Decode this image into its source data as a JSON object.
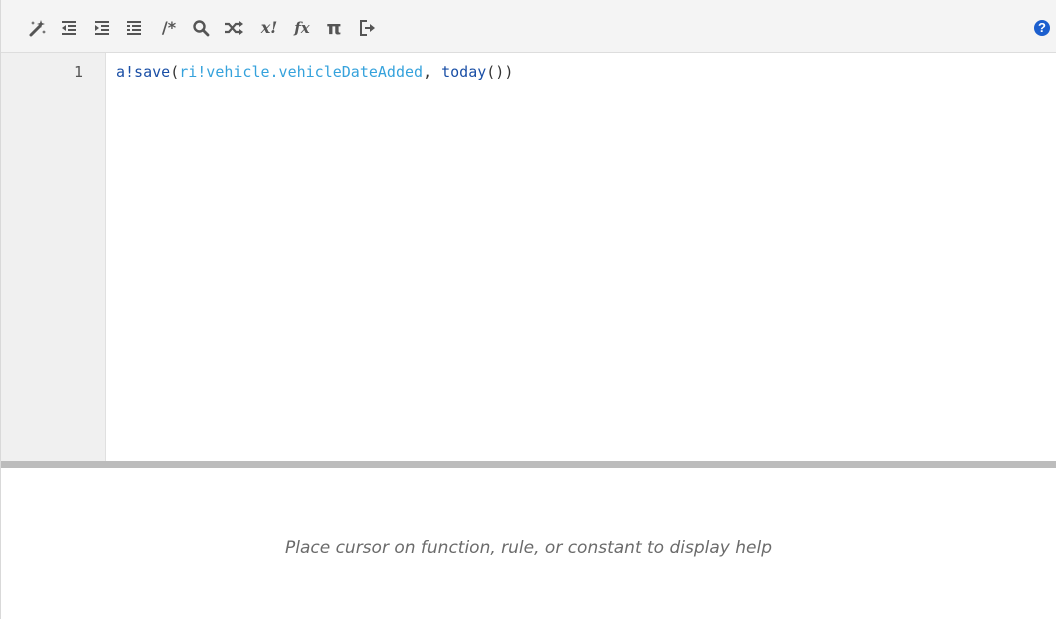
{
  "toolbar": {
    "buttons": [
      {
        "id": "format",
        "icon": "magic-wand-icon",
        "label": ""
      },
      {
        "id": "outdent",
        "icon": "outdent-icon",
        "label": ""
      },
      {
        "id": "indent",
        "icon": "indent-icon",
        "label": ""
      },
      {
        "id": "list",
        "icon": "list-icon",
        "label": ""
      },
      {
        "id": "comment",
        "icon": "comment-icon",
        "label": "/*"
      },
      {
        "id": "search",
        "icon": "search-icon",
        "label": ""
      },
      {
        "id": "shuffle",
        "icon": "shuffle-icon",
        "label": ""
      },
      {
        "id": "variable",
        "icon": "variable-icon",
        "label": "x!"
      },
      {
        "id": "function",
        "icon": "function-icon",
        "label": "fx"
      },
      {
        "id": "constant",
        "icon": "pi-icon",
        "label": "π"
      },
      {
        "id": "exit",
        "icon": "exit-icon",
        "label": ""
      }
    ],
    "help_label": "?"
  },
  "editor": {
    "lines": [
      {
        "number": "1",
        "tokens": {
          "t1": "a!save",
          "t2": "(",
          "t3": "ri!vehicle.vehicleDateAdded",
          "t4": ", ",
          "t5": "today",
          "t6": "())"
        }
      }
    ]
  },
  "help_panel": {
    "message": "Place cursor on function, rule, or constant to display help"
  },
  "colors": {
    "function_token": "#1a4fa6",
    "rule_token": "#35a2dc",
    "help_icon": "#1c5fce",
    "toolbar_bg": "#f4f4f4",
    "gutter_bg": "#f0f0f0",
    "splitter": "#bcbcbc"
  }
}
